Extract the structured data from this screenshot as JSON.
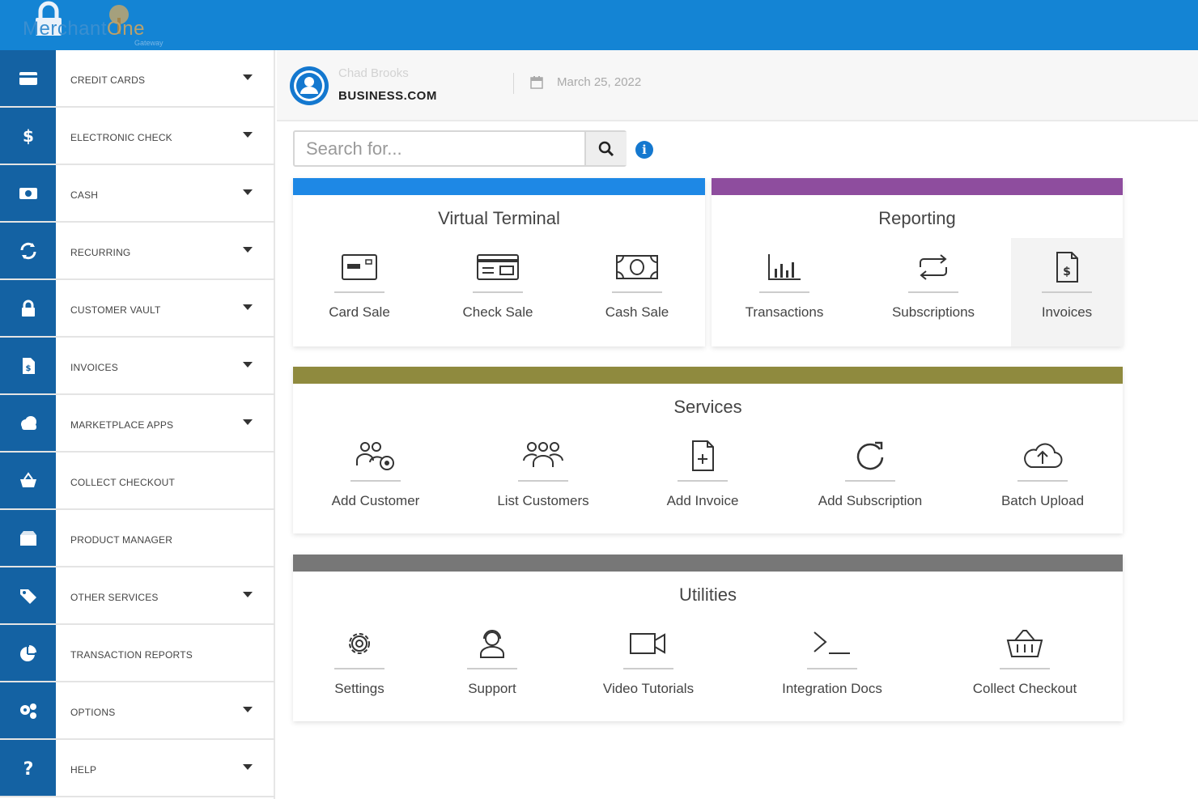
{
  "brand": {
    "name_part1": "Merchant",
    "name_part2": "One",
    "sub": "Gateway"
  },
  "user": {
    "name": "Chad Brooks",
    "company": "BUSINESS.COM",
    "date": "March 25, 2022"
  },
  "search": {
    "placeholder": "Search for..."
  },
  "info_icon_glyph": "i",
  "sidebar": {
    "items": [
      {
        "label": "CREDIT CARDS",
        "icon": "credit-card-icon"
      },
      {
        "label": "ELECTRONIC CHECK",
        "icon": "dollar-icon"
      },
      {
        "label": "CASH",
        "icon": "cash-icon"
      },
      {
        "label": "RECURRING",
        "icon": "refresh-icon"
      },
      {
        "label": "CUSTOMER VAULT",
        "icon": "lock-icon"
      },
      {
        "label": "INVOICES",
        "icon": "invoice-icon"
      },
      {
        "label": "MARKETPLACE APPS",
        "icon": "cloud-icon"
      },
      {
        "label": "COLLECT CHECKOUT",
        "icon": "basket-icon"
      },
      {
        "label": "PRODUCT MANAGER",
        "icon": "box-icon"
      },
      {
        "label": "OTHER SERVICES",
        "icon": "tags-icon"
      },
      {
        "label": "TRANSACTION REPORTS",
        "icon": "pie-chart-icon"
      },
      {
        "label": "OPTIONS",
        "icon": "gears-icon"
      },
      {
        "label": "HELP",
        "icon": "question-icon"
      }
    ]
  },
  "panels": {
    "virtual_terminal": {
      "title": "Virtual Terminal",
      "color": "#1e88e5",
      "tiles": [
        "Card Sale",
        "Check Sale",
        "Cash Sale"
      ]
    },
    "reporting": {
      "title": "Reporting",
      "color": "#8e4d9e",
      "tiles": [
        "Transactions",
        "Subscriptions",
        "Invoices"
      ]
    },
    "services": {
      "title": "Services",
      "color": "#8f8a3e",
      "tiles": [
        "Add Customer",
        "List Customers",
        "Add Invoice",
        "Add Subscription",
        "Batch Upload"
      ]
    },
    "utilities": {
      "title": "Utilities",
      "color": "#777777",
      "tiles": [
        "Settings",
        "Support",
        "Video Tutorials",
        "Integration Docs",
        "Collect Checkout"
      ]
    }
  },
  "colors": {
    "topbar": "#1484d4",
    "sidebar_icon_bg": "#1462a3",
    "accent": "#1478cf"
  }
}
